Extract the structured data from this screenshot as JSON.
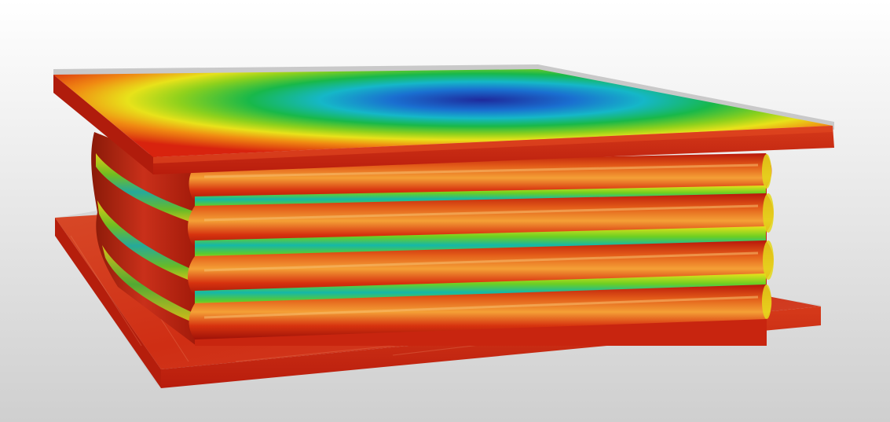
{
  "scene": {
    "description_hidden": "",
    "background_top": "#ffffff",
    "background_bottom": "#cfcfcf",
    "colormap": [
      "#1e2a9c",
      "#1a6fd0",
      "#15b7c8",
      "#18b84a",
      "#8fd11c",
      "#e8e21a",
      "#f08a12",
      "#d8230e",
      "#c1170a"
    ],
    "plate_edge_color": "#c9c9c9",
    "dominant_color": "#c92a12"
  }
}
